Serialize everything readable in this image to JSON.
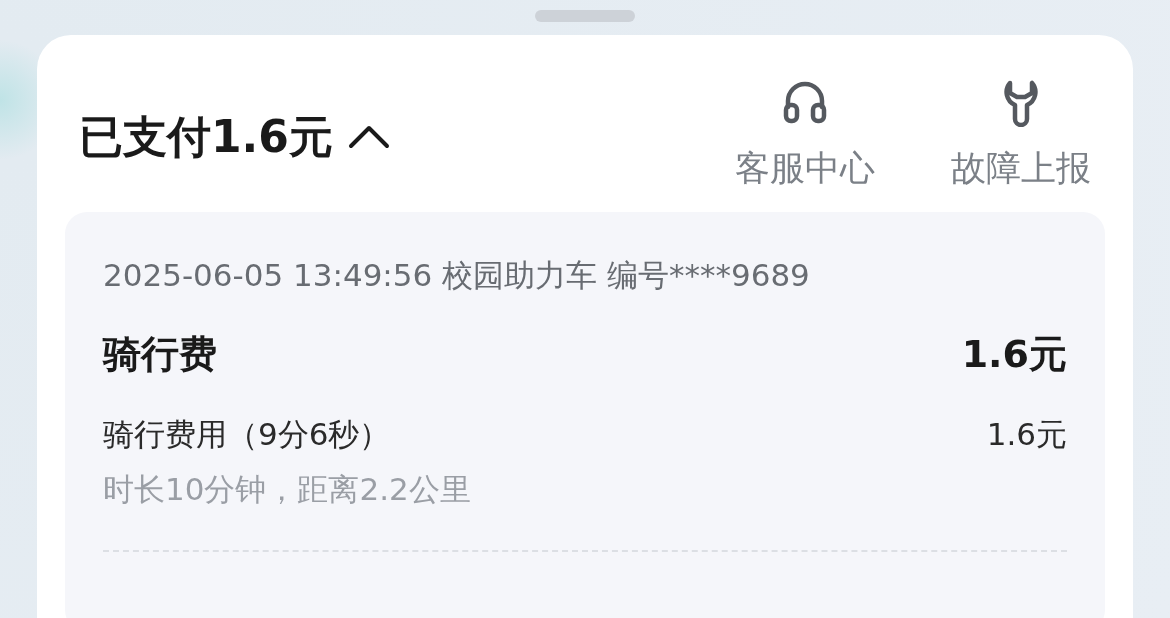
{
  "header": {
    "title": "已支付1.6元",
    "expanded": true
  },
  "actions": [
    {
      "kind": "headset",
      "label": "客服中心"
    },
    {
      "kind": "wrench",
      "label": "故障上报"
    }
  ],
  "order": {
    "info": "2025-06-05 13:49:56 校园助力车 编号****9689",
    "fee_title": "骑行费",
    "fee_total": "1.6元",
    "items": [
      {
        "label": "骑行费用（9分6秒）",
        "amount": "1.6元",
        "note": "时长10分钟，距离2.2公里"
      }
    ]
  }
}
